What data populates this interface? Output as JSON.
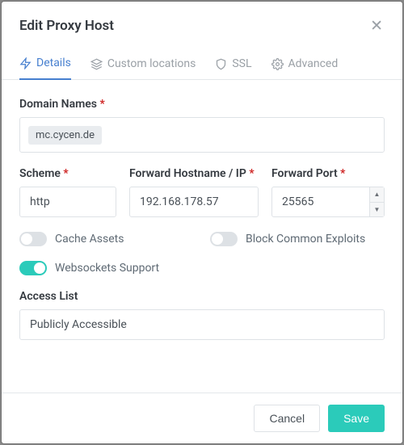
{
  "modal": {
    "title": "Edit Proxy Host"
  },
  "tabs": {
    "details": "Details",
    "custom_locations": "Custom locations",
    "ssl": "SSL",
    "advanced": "Advanced"
  },
  "labels": {
    "domain_names": "Domain Names",
    "scheme": "Scheme",
    "forward_hostname": "Forward Hostname / IP",
    "forward_port": "Forward Port",
    "access_list": "Access List"
  },
  "values": {
    "domain_chip": "mc.cycen.de",
    "scheme": "http",
    "forward_hostname": "192.168.178.57",
    "forward_port": "25565",
    "access_list": "Publicly Accessible"
  },
  "toggles": {
    "cache_assets": "Cache Assets",
    "block_exploits": "Block Common Exploits",
    "websockets": "Websockets Support"
  },
  "buttons": {
    "cancel": "Cancel",
    "save": "Save"
  }
}
